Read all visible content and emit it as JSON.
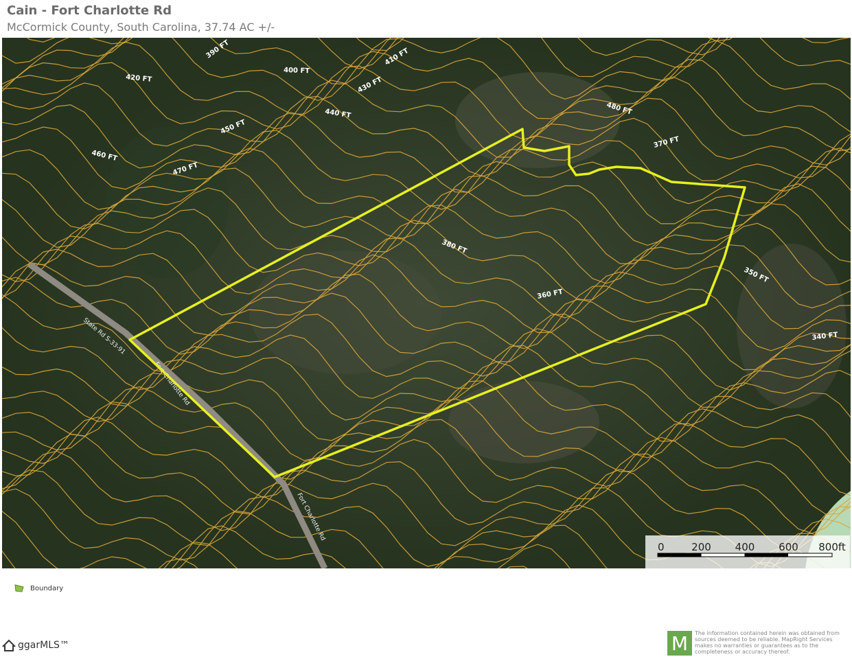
{
  "header": {
    "title": "Cain - Fort Charlotte Rd",
    "subtitle": "McCormick County, South Carolina, 37.74 AC +/-"
  },
  "colors": {
    "boundary": "#e6f020",
    "contour": "#d9a63a",
    "forest": "#2f3b2a",
    "road": "#8f8a82",
    "water": "#b8d9b6"
  },
  "contour_labels": [
    "390 FT",
    "400 FT",
    "410 FT",
    "420 FT",
    "430 FT",
    "440 FT",
    "450 FT",
    "460 FT",
    "470 FT",
    "480 FT",
    "370 FT",
    "380 FT",
    "360 FT",
    "350 FT",
    "340 FT"
  ],
  "road_labels": [
    "Fort Charlotte Rd",
    "State Rd S-33-91",
    "Fort Charlotte Rd"
  ],
  "scalebar": {
    "ticks": [
      "0",
      "200",
      "400",
      "600",
      "800ft"
    ]
  },
  "legend": {
    "label": "Boundary",
    "icon": "boundary-polygon-icon"
  },
  "footer": {
    "mls": "ggarMLS™",
    "mapright_logo": "M",
    "disclaimer": "The information contained herein was obtained from sources deemed to be reliable. MapRight Services makes no warranties or guarantees as to the completeness or accuracy thereof."
  }
}
